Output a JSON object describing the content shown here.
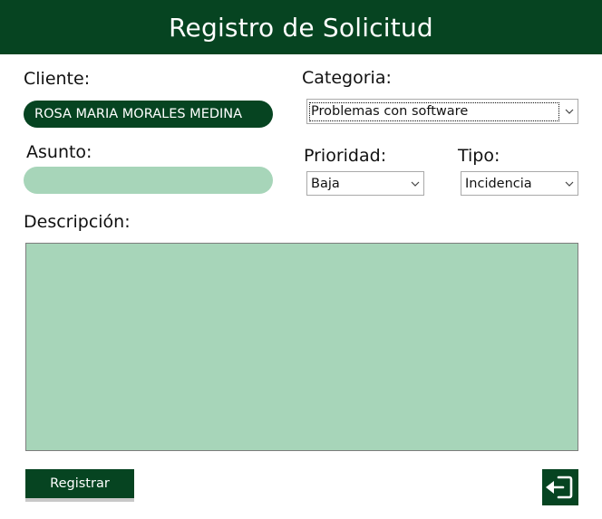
{
  "window": {
    "title": "Registro de Solicitud"
  },
  "form": {
    "cliente_label": "Cliente:",
    "cliente_value": "ROSA MARIA MORALES MEDINA",
    "asunto_label": "Asunto:",
    "asunto_value": "",
    "categoria_label": "Categoria:",
    "categoria_value": "Problemas con software",
    "prioridad_label": "Prioridad:",
    "prioridad_value": "Baja",
    "tipo_label": "Tipo:",
    "tipo_value": "Incidencia",
    "descripcion_label": "Descripción:",
    "descripcion_value": ""
  },
  "actions": {
    "register_label": "Registrar",
    "exit_icon": "exit-door-icon"
  },
  "colors": {
    "primary": "#064421",
    "field_bg": "#a7d5b9"
  }
}
